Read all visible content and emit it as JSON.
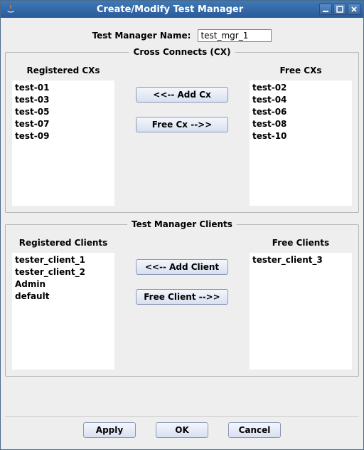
{
  "window": {
    "title": "Create/Modify Test Manager"
  },
  "name_field": {
    "label": "Test Manager Name:",
    "value": "test_mgr_1"
  },
  "cx": {
    "legend": "Cross Connects (CX)",
    "registered_header": "Registered CXs",
    "free_header": "Free CXs",
    "add_label": "<<--  Add Cx",
    "free_label": "Free Cx -->>",
    "registered": [
      "test-01",
      "test-03",
      "test-05",
      "test-07",
      "test-09"
    ],
    "free": [
      "test-02",
      "test-04",
      "test-06",
      "test-08",
      "test-10"
    ]
  },
  "clients": {
    "legend": "Test Manager Clients",
    "registered_header": "Registered Clients",
    "free_header": "Free Clients",
    "add_label": "<<--  Add Client",
    "free_label": "Free Client -->>",
    "registered": [
      "tester_client_1",
      "tester_client_2",
      "Admin",
      "default"
    ],
    "free": [
      "tester_client_3"
    ]
  },
  "footer": {
    "apply": "Apply",
    "ok": "OK",
    "cancel": "Cancel"
  }
}
